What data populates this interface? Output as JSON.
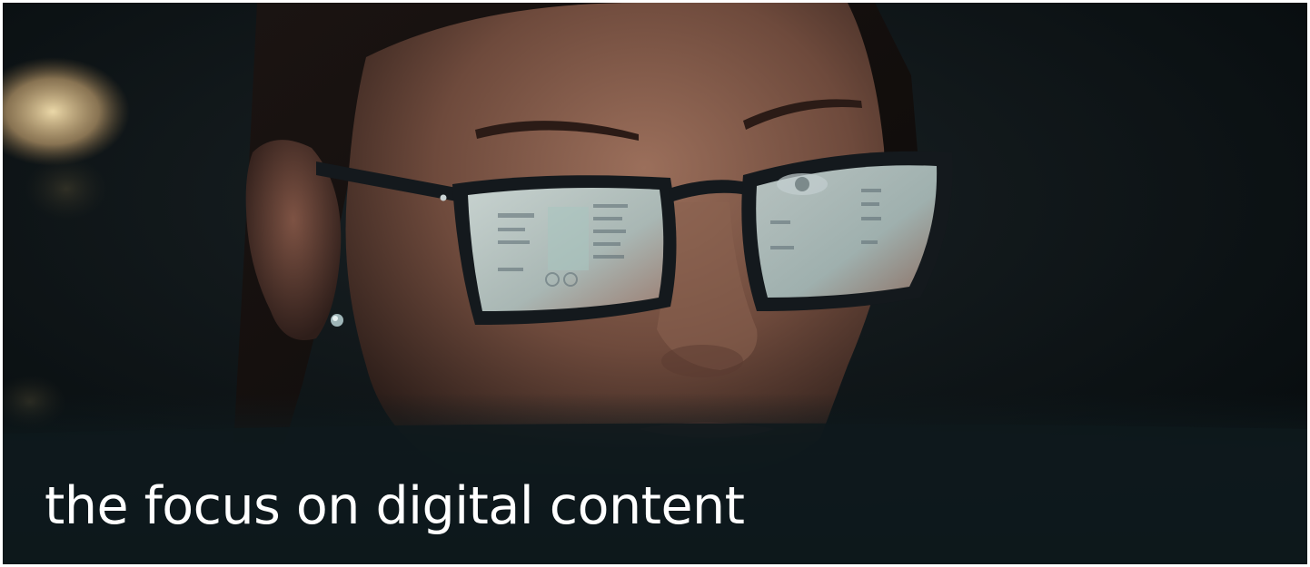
{
  "hero": {
    "caption": "the focus on digital content",
    "image": {
      "subject": "woman-wearing-glasses-reflecting-screen-icon",
      "colors": {
        "background": "#0a1114",
        "skin": "#7a5646",
        "frames": "#14191d",
        "lens_glow": "#b9c6c4",
        "bokeh_light": "#e8c994"
      }
    }
  }
}
